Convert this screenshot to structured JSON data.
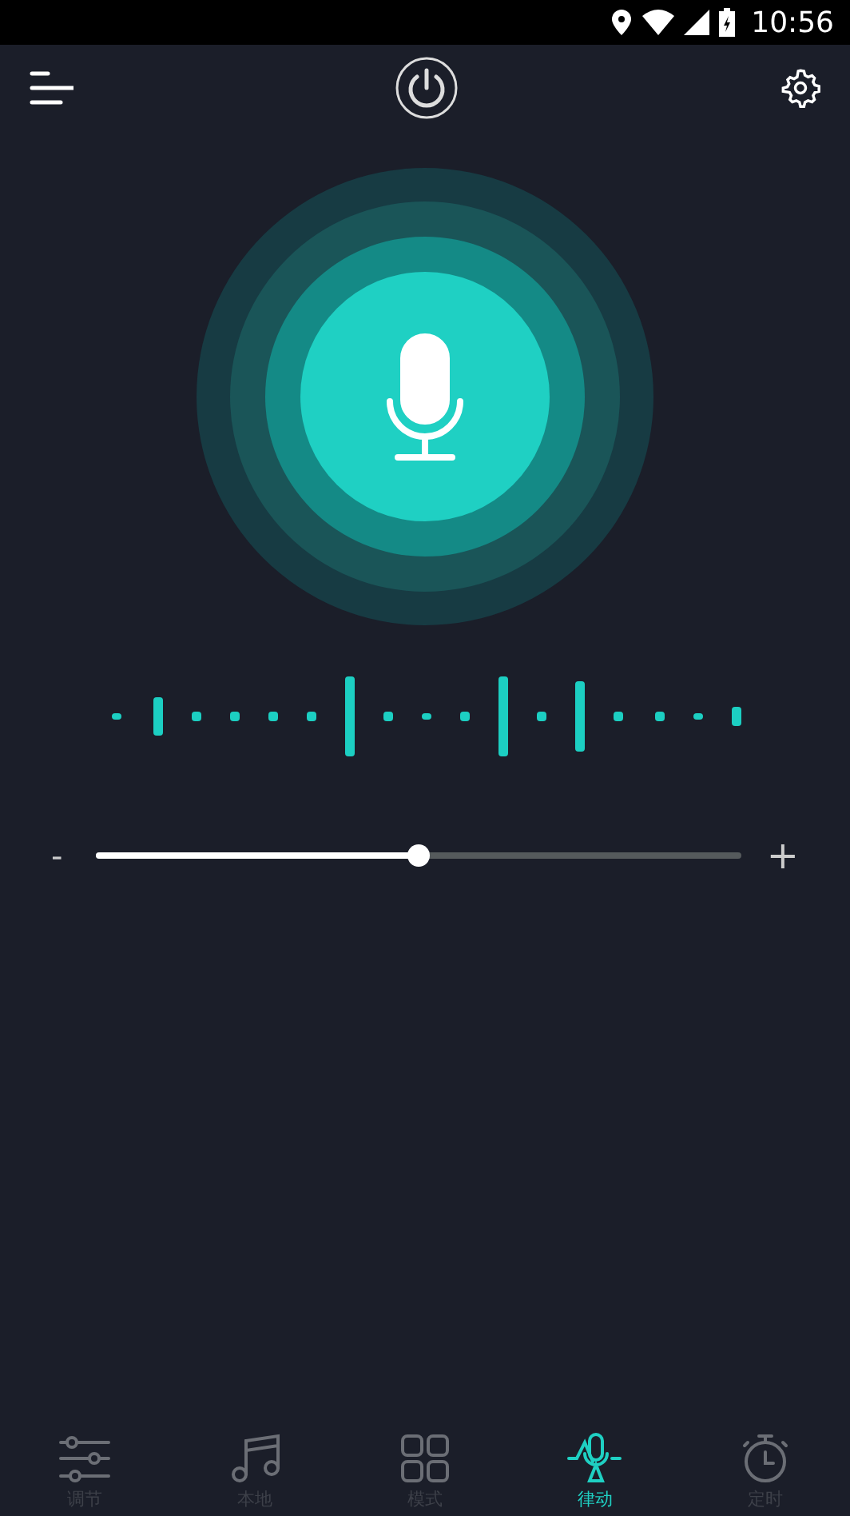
{
  "status_bar": {
    "time": "10:56"
  },
  "volume": {
    "minus": "-",
    "plus": "+",
    "level": 0.5
  },
  "tabs": [
    {
      "label": "调节",
      "selected": false,
      "kind": "sliders"
    },
    {
      "label": "本地",
      "selected": false,
      "kind": "music"
    },
    {
      "label": "模式",
      "selected": false,
      "kind": "grid"
    },
    {
      "label": "律动",
      "selected": true,
      "kind": "pulse"
    },
    {
      "label": "定时",
      "selected": false,
      "kind": "timer"
    }
  ]
}
